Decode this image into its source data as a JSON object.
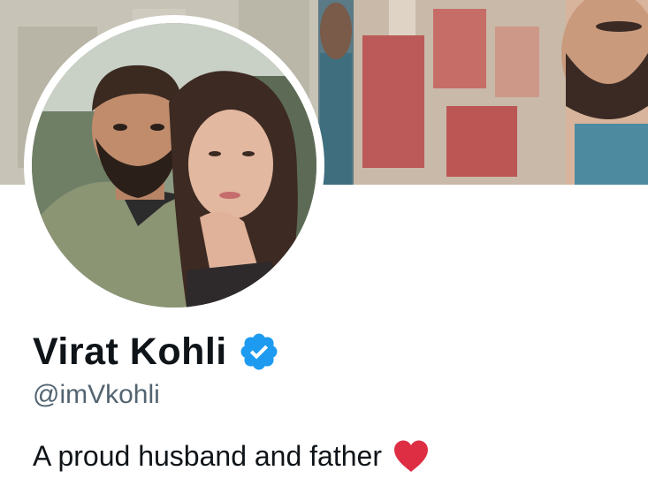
{
  "profile": {
    "display_name": "Virat Kohli",
    "handle": "@imVkohli",
    "bio": "A proud husband and father",
    "verified": true
  },
  "icons": {
    "verified_badge": "verified-badge-icon",
    "bio_emoji": "red-heart-icon"
  },
  "colors": {
    "name": "#0f1419",
    "handle": "#536471",
    "verified_blue": "#1d9bf0",
    "heart_red": "#dd2e44"
  }
}
